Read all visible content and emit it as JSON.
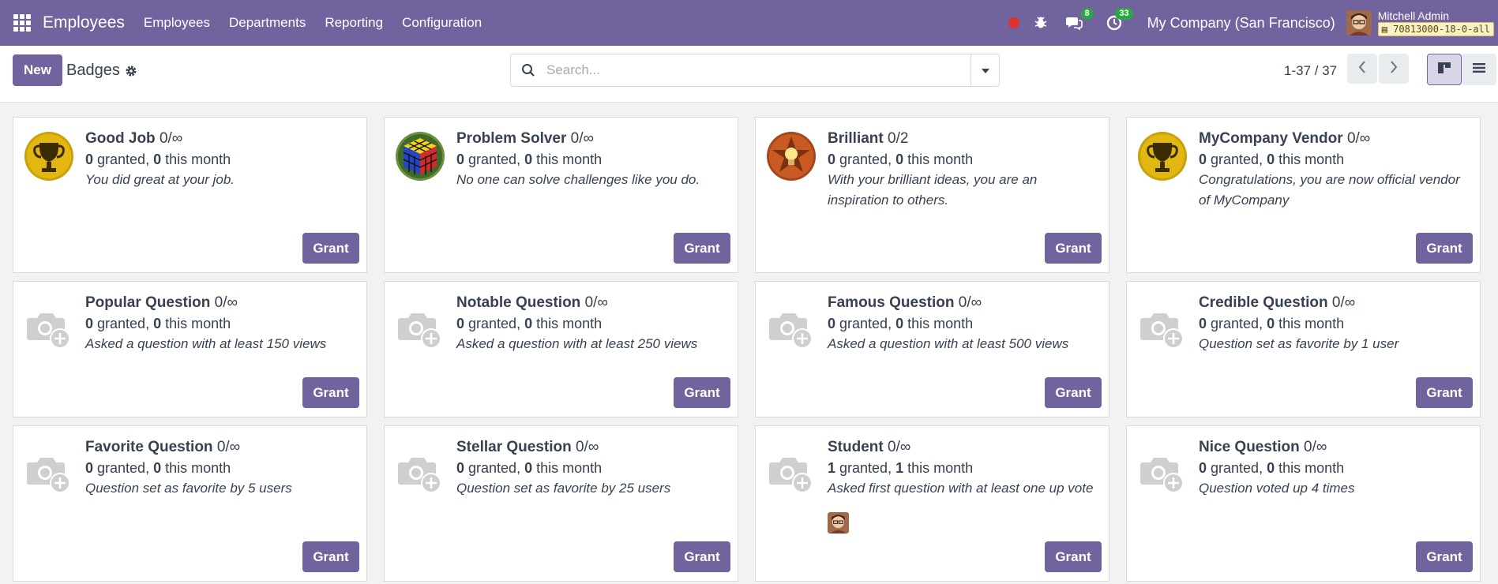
{
  "navbar": {
    "app_name": "Employees",
    "menu": [
      "Employees",
      "Departments",
      "Reporting",
      "Configuration"
    ],
    "messages_count": "8",
    "activities_count": "33",
    "company": "My Company (San Francisco)",
    "user_name": "Mitchell Admin",
    "database": "70813000-18-0-all"
  },
  "control": {
    "new_label": "New",
    "breadcrumb": "Badges",
    "search_placeholder": "Search...",
    "pager": "1-37 / 37"
  },
  "badges": [
    {
      "name": "Good Job",
      "limit": "0/∞",
      "granted": "0",
      "month": "0",
      "desc": "You did great at your job.",
      "icon": "trophy-icon"
    },
    {
      "name": "Problem Solver",
      "limit": "0/∞",
      "granted": "0",
      "month": "0",
      "desc": "No one can solve challenges like you do.",
      "icon": "rubiks-cube-icon"
    },
    {
      "name": "Brilliant",
      "limit": "0/2",
      "granted": "0",
      "month": "0",
      "desc": "With your brilliant ideas, you are an inspiration to others.",
      "icon": "lightbulb-star-icon"
    },
    {
      "name": "MyCompany Vendor",
      "limit": "0/∞",
      "granted": "0",
      "month": "0",
      "desc": "Congratulations, you are now official vendor of MyCompany",
      "icon": "trophy-icon"
    },
    {
      "name": "Popular Question",
      "limit": "0/∞",
      "granted": "0",
      "month": "0",
      "desc": "Asked a question with at least 150 views",
      "icon": "camera-placeholder-icon"
    },
    {
      "name": "Notable Question",
      "limit": "0/∞",
      "granted": "0",
      "month": "0",
      "desc": "Asked a question with at least 250 views",
      "icon": "camera-placeholder-icon"
    },
    {
      "name": "Famous Question",
      "limit": "0/∞",
      "granted": "0",
      "month": "0",
      "desc": "Asked a question with at least 500 views",
      "icon": "camera-placeholder-icon"
    },
    {
      "name": "Credible Question",
      "limit": "0/∞",
      "granted": "0",
      "month": "0",
      "desc": "Question set as favorite by 1 user",
      "icon": "camera-placeholder-icon"
    },
    {
      "name": "Favorite Question",
      "limit": "0/∞",
      "granted": "0",
      "month": "0",
      "desc": "Question set as favorite by 5 users",
      "icon": "camera-placeholder-icon"
    },
    {
      "name": "Stellar Question",
      "limit": "0/∞",
      "granted": "0",
      "month": "0",
      "desc": "Question set as favorite by 25 users",
      "icon": "camera-placeholder-icon"
    },
    {
      "name": "Student",
      "limit": "0/∞",
      "granted": "1",
      "month": "1",
      "desc": "Asked first question with at least one up vote",
      "icon": "camera-placeholder-icon"
    },
    {
      "name": "Nice Question",
      "limit": "0/∞",
      "granted": "0",
      "month": "0",
      "desc": "Question voted up 4 times",
      "icon": "camera-placeholder-icon"
    }
  ],
  "labels": {
    "granted": " granted, ",
    "this_month": " this month",
    "grant": "Grant"
  },
  "colors": {
    "brand": "#71639e",
    "badge_green": "#28a745",
    "record_red": "#e0312e"
  }
}
